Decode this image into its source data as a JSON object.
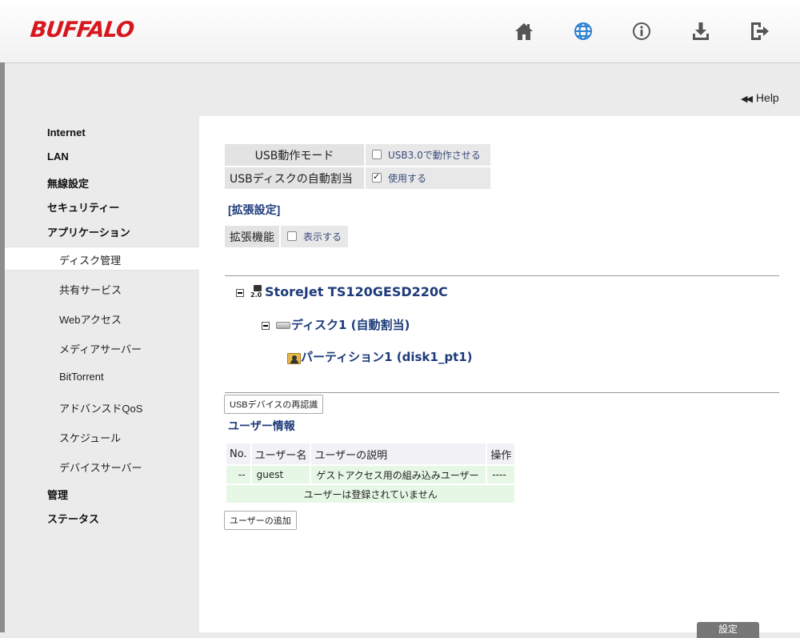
{
  "header": {
    "logo": "BUFFALO",
    "icons": [
      "home-icon",
      "globe-icon",
      "info-icon",
      "download-icon",
      "logout-icon"
    ]
  },
  "help": {
    "label": "Help"
  },
  "sidebar": {
    "internet": "Internet",
    "lan": "LAN",
    "wireless": "無線設定",
    "security": "セキュリティー",
    "application": "アプリケーション",
    "sub": {
      "disk": "ディスク管理",
      "share": "共有サービス",
      "web": "Webアクセス",
      "media": "メディアサーバー",
      "bittorrent": "BitTorrent",
      "qos": "アドバンスドQoS",
      "schedule": "スケジュール",
      "device": "デバイスサーバー"
    },
    "admin": "管理",
    "status": "ステータス"
  },
  "settings": {
    "usb_mode_label": "USB動作モード",
    "usb_mode_value": "USB3.0で動作させる",
    "auto_assign_label": "USBディスクの自動割当",
    "auto_assign_value": "使用する"
  },
  "extended": {
    "title": "[拡張設定]",
    "label": "拡張機能",
    "value": "表示する"
  },
  "tree": {
    "usb_badge": "2.0",
    "device": "StoreJet TS120GESD220C",
    "disk": "ディスク1 (自動割当)",
    "partition": "パーティション1 (disk1_pt1)"
  },
  "buttons": {
    "rescan": "USBデバイスの再認識",
    "add_user": "ユーザーの追加",
    "save": "設定"
  },
  "users": {
    "title": "ユーザー情報",
    "headers": [
      "No.",
      "ユーザー名",
      "ユーザーの説明",
      "操作"
    ],
    "row": [
      "--",
      "guest",
      "ゲストアクセス用の組み込みユーザー",
      "----"
    ],
    "empty": "ユーザーは登録されていません"
  },
  "colors": {
    "brand": "#d6171e",
    "link": "#1d3b7a",
    "globe": "#2a7fd4"
  }
}
